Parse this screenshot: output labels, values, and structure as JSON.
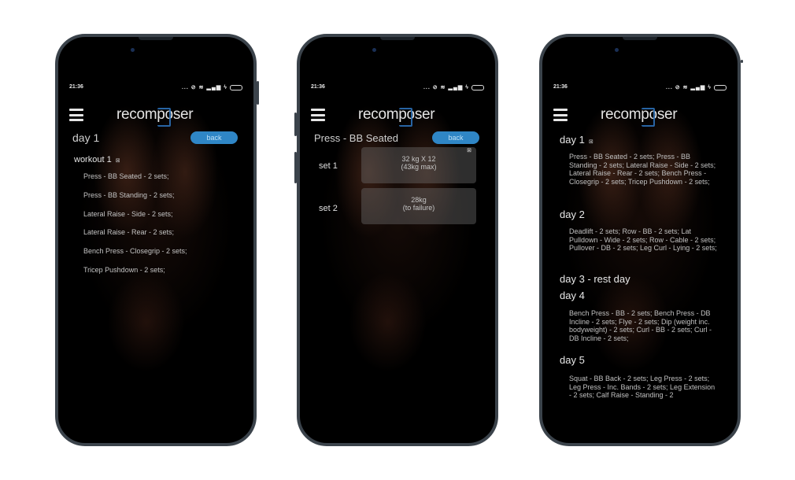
{
  "app": {
    "logo": "recomposer",
    "accent_color": "#2f86c6"
  },
  "status_bar": {
    "time": "21:36",
    "icons": [
      "more-dots-icon",
      "alarm-off-icon",
      "wifi-icon",
      "signal-icon",
      "charging-icon",
      "battery-icon"
    ],
    "dots": "..."
  },
  "screen1": {
    "title": "day 1",
    "back_label": "back",
    "workout": {
      "title": "workout 1",
      "close_glyph": "⊠"
    },
    "exercises": [
      "Press - BB Seated - 2 sets;",
      "Press - BB Standing - 2 sets;",
      "Lateral Raise - Side - 2 sets;",
      "Lateral Raise - Rear - 2 sets;",
      "Bench Press - Closegrip - 2 sets;",
      "Tricep Pushdown - 2 sets;"
    ]
  },
  "screen2": {
    "title": "Press - BB Seated",
    "back_label": "back",
    "sets": [
      {
        "label": "set 1",
        "line1": "32 kg X 12",
        "line2": "(43kg max)",
        "close_glyph": "⊠"
      },
      {
        "label": "set 2",
        "line1": "28kg",
        "line2": "(to failure)"
      }
    ]
  },
  "screen3": {
    "days": [
      {
        "title": "day 1",
        "close_glyph": "⊠",
        "body": "Press - BB Seated - 2 sets; Press - BB Standing - 2 sets; Lateral Raise - Side - 2 sets; Lateral Raise - Rear - 2 sets; Bench Press - Closegrip - 2 sets; Tricep Pushdown - 2 sets;"
      },
      {
        "title": "day 2",
        "body": "Deadlift - 2 sets; Row - BB - 2 sets; Lat Pulldown - Wide - 2 sets; Row - Cable - 2 sets; Pullover - DB - 2 sets; Leg Curl - Lying - 2 sets;"
      },
      {
        "title": "day 3 - rest day",
        "body": ""
      },
      {
        "title": "day 4",
        "body": "Bench Press - BB - 2 sets; Bench Press - DB Incline - 2 sets; Flye - 2 sets; Dip (weight inc. bodyweight) - 2 sets; Curl - BB - 2 sets; Curl - DB Incline - 2 sets;"
      },
      {
        "title": "day 5",
        "body": "Squat - BB Back - 2 sets; Leg Press - 2 sets; Leg Press - Inc. Bands - 2 sets; Leg Extension - 2 sets; Calf Raise - Standing - 2"
      }
    ]
  }
}
